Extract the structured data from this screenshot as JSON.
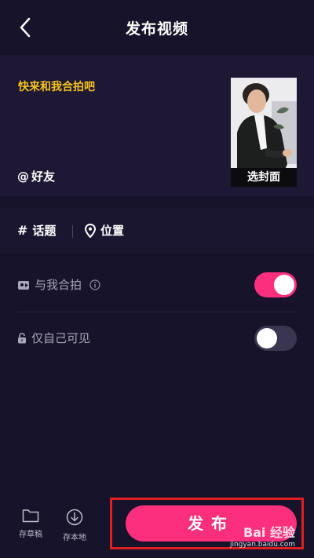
{
  "header": {
    "title": "发布视频"
  },
  "post": {
    "caption": "快来和我合拍吧",
    "mention_label": "好友",
    "cover_label": "选封面"
  },
  "tags": {
    "topic_label": "话题",
    "location_label": "位置"
  },
  "settings": {
    "duet_label": "与我合拍",
    "duet_enabled": true,
    "private_label": "仅自己可见",
    "private_enabled": false
  },
  "bottom": {
    "draft_label": "存草稿",
    "save_local_label": "存本地",
    "publish_label": "发布"
  },
  "watermark": {
    "brand": "Bai 经验",
    "url": "jingyan.baidu.com"
  },
  "colors": {
    "accent": "#fc2f7c",
    "caption": "#f4c31c",
    "background": "#17132b",
    "highlight_frame": "#e02020"
  }
}
